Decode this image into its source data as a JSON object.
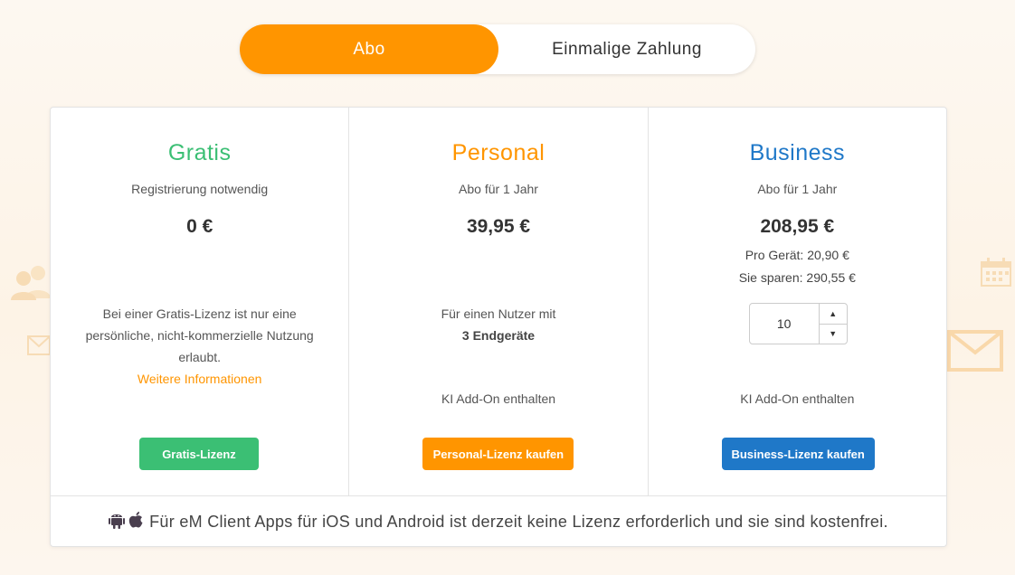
{
  "billing_toggle": {
    "options": [
      "Abo",
      "Einmalige Zahlung"
    ],
    "selected": "Abo"
  },
  "colors": {
    "accent_orange": "#ff9500",
    "gratis_green": "#3bbf74",
    "business_blue": "#1f78c8"
  },
  "plans": [
    {
      "title": "Gratis",
      "subtitle": "Registrierung notwendig",
      "price": "0 €",
      "description": "Bei einer Gratis-Lizenz ist nur eine persönliche, nicht-kommerzielle Nutzung erlaubt.",
      "link": "Weitere Informationen",
      "button": "Gratis-Lizenz"
    },
    {
      "title": "Personal",
      "subtitle": "Abo für 1 Jahr",
      "price": "39,95 €",
      "description": "Für einen Nutzer mit",
      "description_bold": "3 Endgeräte",
      "addon": "KI Add-On enthalten",
      "button": "Personal-Lizenz kaufen"
    },
    {
      "title": "Business",
      "subtitle": "Abo für 1 Jahr",
      "price": "208,95 €",
      "per_device": "Pro Gerät: 20,90 €",
      "savings": "Sie sparen: 290,55 €",
      "quantity": "10",
      "addon": "KI Add-On enthalten",
      "button": "Business-Lizenz kaufen"
    }
  ],
  "footer": {
    "icons": [
      "android-icon",
      "apple-icon"
    ],
    "text": "Für eM Client Apps für iOS und Android ist derzeit keine Lizenz erforderlich und sie sind kostenfrei."
  }
}
